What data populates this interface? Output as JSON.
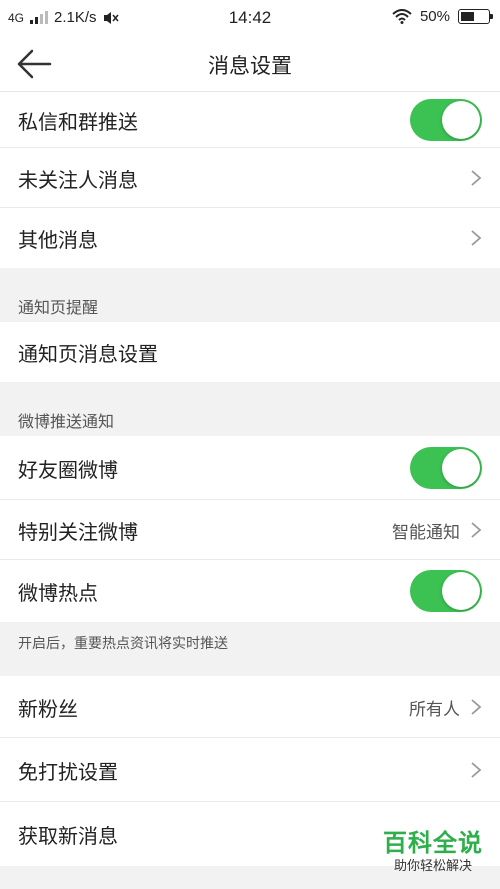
{
  "status_bar": {
    "network": "4G",
    "speed": "2.1K/s",
    "time": "14:42",
    "battery_text": "50%",
    "battery_level": 0.5,
    "icons": [
      "signal-icon",
      "mute-icon",
      "wifi-icon",
      "battery-icon"
    ]
  },
  "nav": {
    "title": "消息设置",
    "back_icon": "back-arrow-icon"
  },
  "rows": {
    "private_msg": {
      "label": "私信和群推送",
      "toggle_on": true
    },
    "unfollowed_msg": {
      "label": "未关注人消息"
    },
    "other_msg": {
      "label": "其他消息"
    }
  },
  "sections": {
    "notify_page": {
      "header": "通知页提醒",
      "row_label": "通知页消息设置"
    },
    "weibo_push": {
      "header": "微博推送通知",
      "friends_circle": {
        "label": "好友圈微博",
        "toggle_on": true
      },
      "special_follow": {
        "label": "特别关注微博",
        "value": "智能通知"
      },
      "hot_topics": {
        "label": "微博热点",
        "toggle_on": true
      },
      "hint": "开启后，重要热点资讯将实时推送"
    }
  },
  "bottom_rows": {
    "new_fans": {
      "label": "新粉丝",
      "value": "所有人"
    },
    "dnd": {
      "label": "免打扰设置"
    },
    "fetch": {
      "label": "获取新消息"
    }
  },
  "watermark": {
    "main": "百科全说",
    "sub": "助你轻松解决"
  },
  "colors": {
    "toggle_on": "#3cc153",
    "background": "#f2f2f2",
    "watermark": "#2fae4c"
  }
}
